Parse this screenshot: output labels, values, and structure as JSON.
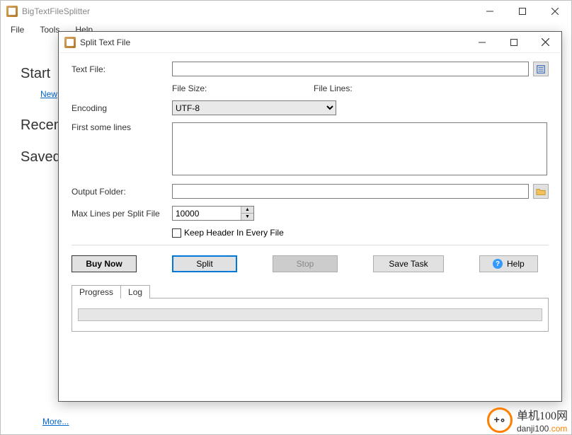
{
  "main": {
    "title": "BigTextFileSplitter",
    "menu": {
      "file": "File",
      "tools": "Tools",
      "help": "Help"
    },
    "headings": {
      "start": "Start",
      "recent": "Recent",
      "saved": "Saved"
    },
    "links": {
      "new": "New",
      "more": "More..."
    }
  },
  "dialog": {
    "title": "Split Text File",
    "labels": {
      "text_file": "Text File:",
      "file_size": "File Size:",
      "file_lines": "File Lines:",
      "encoding": "Encoding",
      "first_lines": "First some lines",
      "output_folder": "Output Folder:",
      "max_lines": "Max Lines per Split File",
      "keep_header": "Keep Header In Every File"
    },
    "values": {
      "text_file": "",
      "encoding_selected": "UTF-8",
      "first_lines": "",
      "output_folder": "",
      "max_lines": "10000"
    },
    "buttons": {
      "buy_now": "Buy Now",
      "split": "Split",
      "stop": "Stop",
      "save_task": "Save Task",
      "help": "Help"
    },
    "tabs": {
      "progress": "Progress",
      "log": "Log"
    }
  },
  "watermark": {
    "logo_text": "+ ∘",
    "cn": "单机100网",
    "url_a": "danji100",
    "url_b": ".com"
  }
}
